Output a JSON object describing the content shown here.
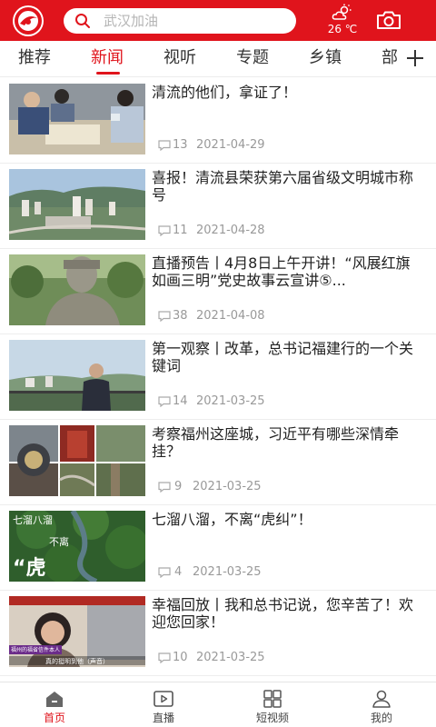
{
  "header": {
    "search_placeholder": "武汉加油",
    "temperature": "26 ℃",
    "weather_icon": "cloud-sun-icon",
    "camera_icon": "camera-icon",
    "brand_color": "#e0141c"
  },
  "tabs": [
    {
      "label": "推荐",
      "active": false
    },
    {
      "label": "新闻",
      "active": true
    },
    {
      "label": "视听",
      "active": false
    },
    {
      "label": "专题",
      "active": false
    },
    {
      "label": "乡镇",
      "active": false
    },
    {
      "label": "部",
      "active": false
    }
  ],
  "articles": [
    {
      "title": "清流的他们，拿证了！",
      "comments": "13",
      "date": "2021-04-29"
    },
    {
      "title": "喜报！清流县荣获第六届省级文明城市称号",
      "comments": "11",
      "date": "2021-04-28"
    },
    {
      "title": "直播预告丨4月8日上午开讲！“风展红旗 如画三明”党史故事云宣讲⑤...",
      "comments": "38",
      "date": "2021-04-08"
    },
    {
      "title": "第一观察丨改革，总书记福建行的一个关键词",
      "comments": "14",
      "date": "2021-03-25"
    },
    {
      "title": "考察福州这座城，习近平有哪些深情牵挂？",
      "comments": "9",
      "date": "2021-03-25"
    },
    {
      "title": "七溜八溜，不离“虎纠”！",
      "comments": "4",
      "date": "2021-03-25"
    },
    {
      "title": "幸福回放丨我和总书记说，您辛苦了！欢迎您回家！",
      "comments": "10",
      "date": "2021-03-25"
    }
  ],
  "thumb_texts": {
    "t6_a": "七溜八溜",
    "t6_b": "不离",
    "t6_c": "“虎",
    "t7_a": "福州的福省信件本人",
    "t7_b": "真的挺明到他（声音）"
  },
  "bottom_nav": [
    {
      "label": "首页",
      "icon": "home-icon",
      "active": true
    },
    {
      "label": "直播",
      "icon": "play-icon",
      "active": false
    },
    {
      "label": "短视频",
      "icon": "grid-icon",
      "active": false
    },
    {
      "label": "我的",
      "icon": "user-icon",
      "active": false
    }
  ]
}
